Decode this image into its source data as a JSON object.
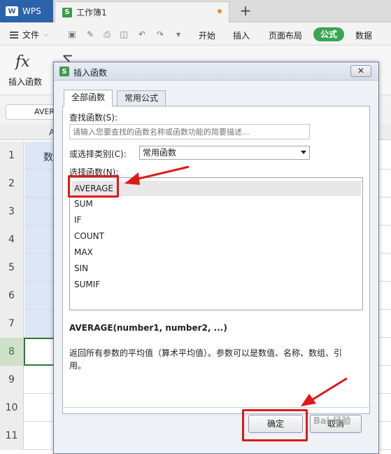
{
  "titlebar": {
    "app_name": "WPS",
    "doc_tab_label": "工作簿1",
    "new_tab_symbol": "+"
  },
  "menubar": {
    "file_label": "文件",
    "items": [
      "开始",
      "插入",
      "页面布局",
      "公式",
      "数据"
    ],
    "active": "公式"
  },
  "ribbon": {
    "fx_symbol": "fx",
    "insert_function_label": "插入函数"
  },
  "formulabar": {
    "namebox_value": "AVER"
  },
  "grid": {
    "col_a_header": "A",
    "rows": [
      "1",
      "2",
      "3",
      "4",
      "5",
      "6",
      "7",
      "8",
      "9",
      "10",
      "11"
    ],
    "active_row": "8",
    "cell_a1_text": "数"
  },
  "dialog": {
    "title": "插入函数",
    "close_symbol": "✕",
    "tabs": [
      "全部函数",
      "常用公式"
    ],
    "search_label": "查找函数(S):",
    "search_placeholder": "请输入您要查找的函数名称或函数功能的简要描述...",
    "category_label": "或选择类别(C):",
    "category_value": "常用函数",
    "select_function_label": "选择函数(N):",
    "functions": [
      "AVERAGE",
      "SUM",
      "IF",
      "COUNT",
      "MAX",
      "SIN",
      "SUMIF"
    ],
    "selected_function": "AVERAGE",
    "signature": "AVERAGE(number1, number2, ...)",
    "description": "返回所有参数的平均值（算术平均值）。参数可以是数值、名称、数组、引用。",
    "ok_label": "确定",
    "cancel_label": "取消"
  },
  "watermark": "Bai 经验",
  "colors": {
    "accent_green": "#3ba552",
    "wps_blue": "#2c62a9",
    "annotation_red": "#e01818"
  }
}
